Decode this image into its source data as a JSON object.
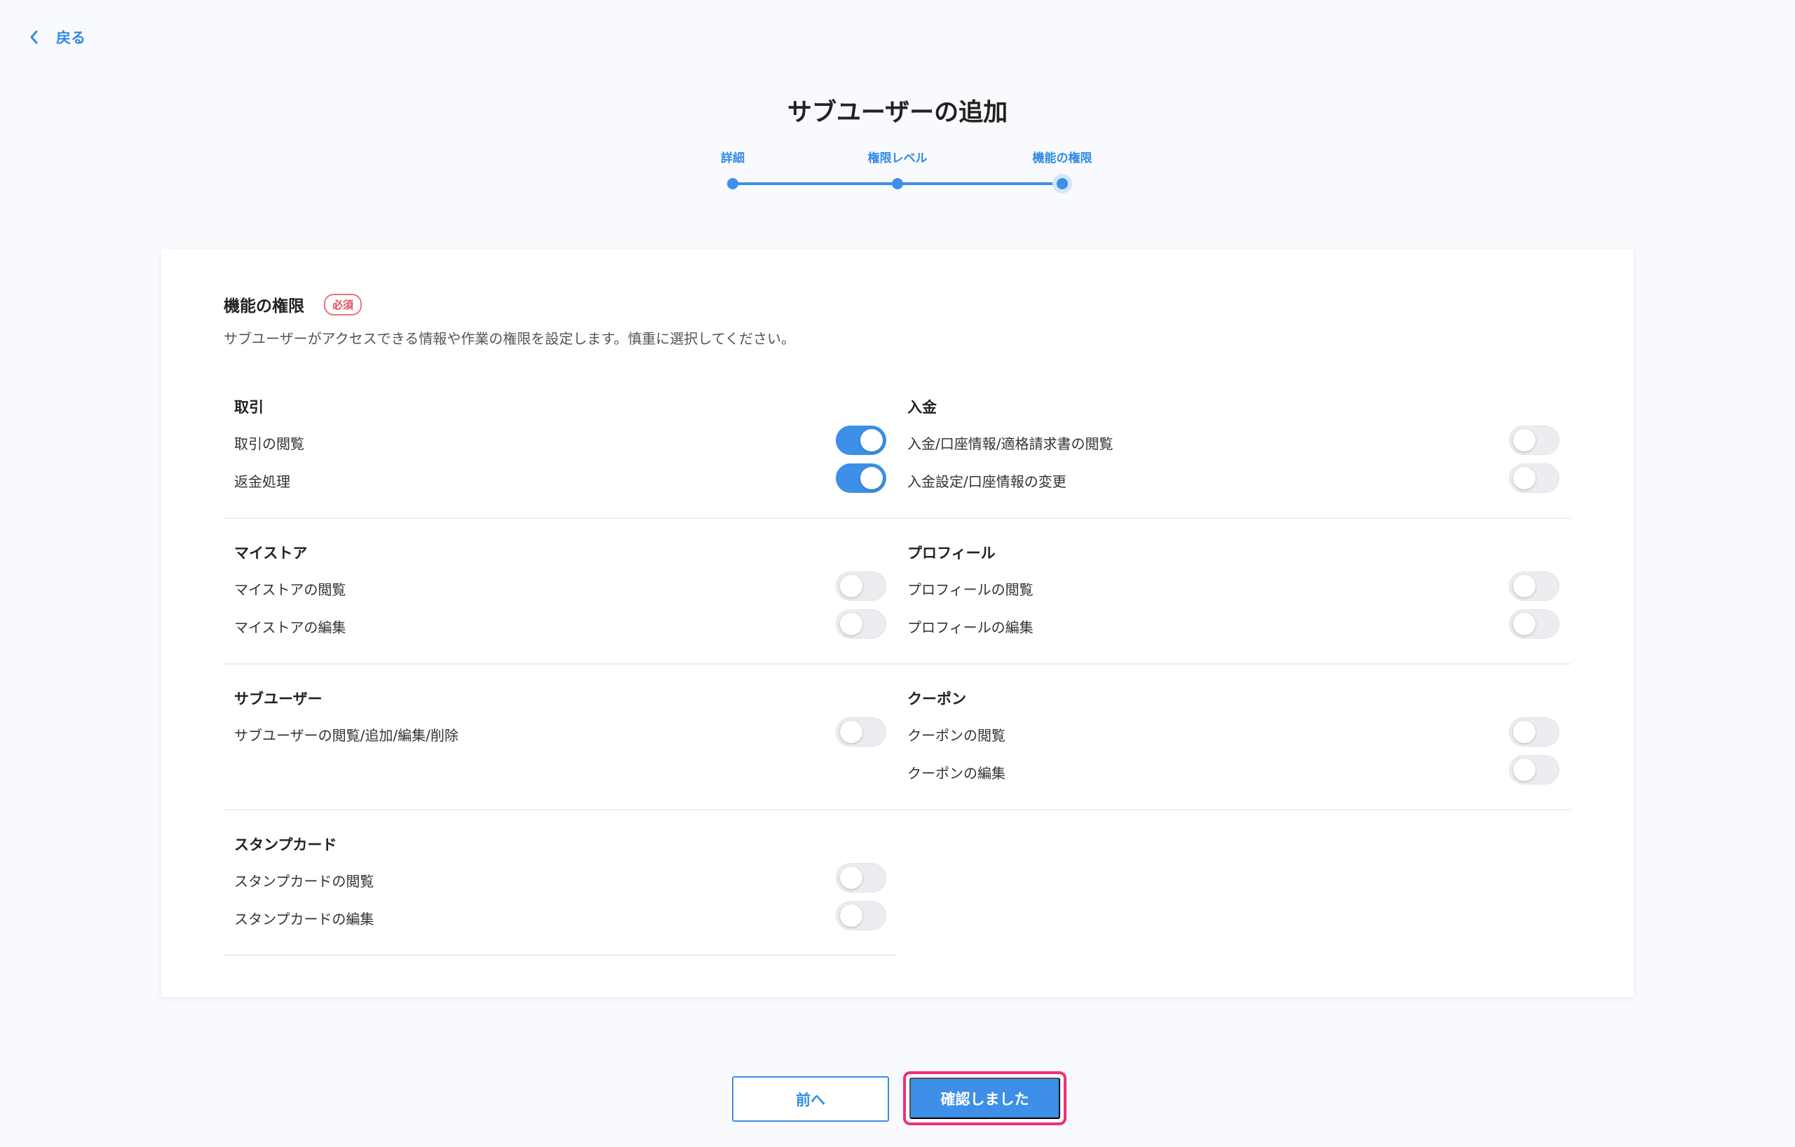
{
  "nav": {
    "back_label": "戻る"
  },
  "page": {
    "title": "サブユーザーの追加"
  },
  "stepper": {
    "steps": [
      {
        "label": "詳細"
      },
      {
        "label": "権限レベル"
      },
      {
        "label": "機能の権限"
      }
    ],
    "current_step": 3
  },
  "card": {
    "title": "機能の権限",
    "required_badge": "必須",
    "description": "サブユーザーがアクセスできる情報や作業の権限を設定します。慎重に選択してください。"
  },
  "groups": [
    {
      "title": "取引",
      "items": [
        {
          "label": "取引の閲覧",
          "enabled": true
        },
        {
          "label": "返金処理",
          "enabled": true
        }
      ]
    },
    {
      "title": "入金",
      "items": [
        {
          "label": "入金/口座情報/適格請求書の閲覧",
          "enabled": false
        },
        {
          "label": "入金設定/口座情報の変更",
          "enabled": false
        }
      ]
    },
    {
      "title": "マイストア",
      "items": [
        {
          "label": "マイストアの閲覧",
          "enabled": false
        },
        {
          "label": "マイストアの編集",
          "enabled": false
        }
      ]
    },
    {
      "title": "プロフィール",
      "items": [
        {
          "label": "プロフィールの閲覧",
          "enabled": false
        },
        {
          "label": "プロフィールの編集",
          "enabled": false
        }
      ]
    },
    {
      "title": "サブユーザー",
      "items": [
        {
          "label": "サブユーザーの閲覧/追加/編集/削除",
          "enabled": false
        }
      ]
    },
    {
      "title": "クーポン",
      "items": [
        {
          "label": "クーポンの閲覧",
          "enabled": false
        },
        {
          "label": "クーポンの編集",
          "enabled": false
        }
      ]
    },
    {
      "title": "スタンプカード",
      "items": [
        {
          "label": "スタンプカードの閲覧",
          "enabled": false
        },
        {
          "label": "スタンプカードの編集",
          "enabled": false
        }
      ]
    }
  ],
  "footer": {
    "prev_label": "前へ",
    "confirm_label": "確認しました"
  },
  "colors": {
    "accent": "#3d8fe8",
    "highlight": "#ee2f7a",
    "required": "#e24b55"
  }
}
